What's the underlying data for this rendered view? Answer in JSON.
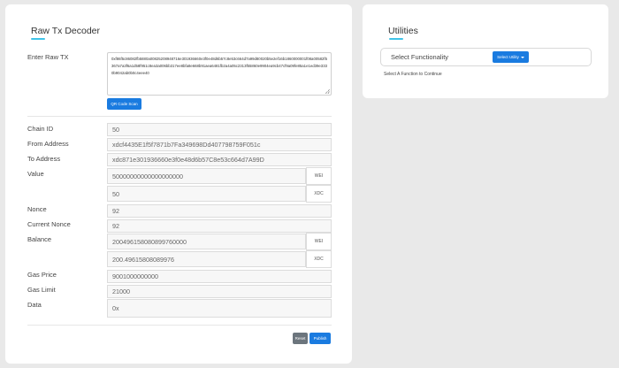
{
  "decoder": {
    "title": "Raw Tx Decoder",
    "raw_tx_label": "Enter Raw TX",
    "raw_tx_value": "0xf86f5c86082fb5880a00825208948716e301936660e3f0e48d6b57c8e53c664d7a99d80020b5e2ef16b1860000001f08a00582f5367a7a3f6a1d58f951c8ea3a006bb317ee8bfa8e668b91aea6481fb2a4a05c2313f55860e9904ea9cb47cf9a09fe85a1e1ed39e3330b9042ab0b0c4eee40",
    "qr_button": "QR Code Scan",
    "fields": {
      "chain_id": {
        "label": "Chain ID",
        "value": "50"
      },
      "from_address": {
        "label": "From Address",
        "value": "xdcf4435E1f5f7871b7Fa349698Dd407798759F051c"
      },
      "to_address": {
        "label": "To Address",
        "value": "xdc871e301936660e3f0e48d6b57C8e53c664d7A99D"
      },
      "value": {
        "label": "Value",
        "wei": "50000000000000000000",
        "xdc": "50",
        "wei_unit": "WEI",
        "xdc_unit": "XDC"
      },
      "nonce": {
        "label": "Nonce",
        "value": "92"
      },
      "current_nonce": {
        "label": "Current Nonce",
        "value": "92"
      },
      "balance": {
        "label": "Balance",
        "wei": "200496158080899760000",
        "xdc": "200.49615808089976",
        "wei_unit": "WEI",
        "xdc_unit": "XDC"
      },
      "gas_price": {
        "label": "Gas Price",
        "value": "9001000000000"
      },
      "gas_limit": {
        "label": "Gas Limit",
        "value": "21000"
      },
      "data": {
        "label": "Data",
        "value": "0x"
      }
    },
    "reset_button": "Reset",
    "publish_button": "Publish"
  },
  "utilities": {
    "title": "Utilities",
    "select_label": "Select Functionality",
    "select_button": "Select Utility",
    "hint": "Select A Function to Continue"
  },
  "colors": {
    "accent_underline": "#3fc3e8",
    "primary_button": "#1a7be0",
    "secondary_button": "#6c757d",
    "background": "#e9e9e9"
  }
}
